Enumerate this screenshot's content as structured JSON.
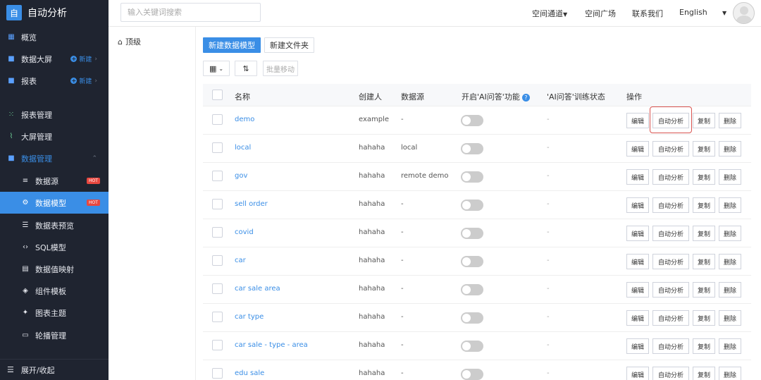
{
  "app": {
    "logo": "自",
    "title": "自动分析"
  },
  "sidebar": {
    "items": [
      {
        "label": "概览"
      },
      {
        "label": "数据大屏",
        "new_label": "新建"
      },
      {
        "label": "报表",
        "new_label": "新建"
      },
      {
        "label": "报表管理"
      },
      {
        "label": "大屏管理"
      },
      {
        "label": "数据管理"
      },
      {
        "label": "数据源",
        "badge": "HOT"
      },
      {
        "label": "数据模型",
        "badge": "HOT"
      },
      {
        "label": "数据表预览"
      },
      {
        "label": "SQL模型"
      },
      {
        "label": "数据值映射"
      },
      {
        "label": "组件模板"
      },
      {
        "label": "图表主题"
      },
      {
        "label": "轮播管理"
      }
    ],
    "footer_label": "展开/收起"
  },
  "topbar": {
    "search_placeholder": "输入关键词搜索",
    "links": [
      "空间通道",
      "空间广场",
      "联系我们",
      "English"
    ]
  },
  "tree": {
    "root_label": "顶级"
  },
  "toolbar": {
    "new_model": "新建数据模型",
    "new_folder": "新建文件夹",
    "batch_move": "批量移动"
  },
  "table": {
    "headers": [
      "名称",
      "创建人",
      "数据源",
      "开启'AI问答'功能",
      "'AI问答'训练状态",
      "操作"
    ],
    "rows": [
      {
        "name": "demo",
        "creator": "example",
        "source": "-",
        "status": "-"
      },
      {
        "name": "local",
        "creator": "hahaha",
        "source": "local",
        "status": "-"
      },
      {
        "name": "gov",
        "creator": "hahaha",
        "source": "remote demo",
        "status": "-"
      },
      {
        "name": "sell order",
        "creator": "hahaha",
        "source": "-",
        "status": "-"
      },
      {
        "name": "covid",
        "creator": "hahaha",
        "source": "-",
        "status": "-"
      },
      {
        "name": "car",
        "creator": "hahaha",
        "source": "-",
        "status": "-"
      },
      {
        "name": "car sale area",
        "creator": "hahaha",
        "source": "-",
        "status": "-"
      },
      {
        "name": "car type",
        "creator": "hahaha",
        "source": "-",
        "status": "-"
      },
      {
        "name": "car sale - type - area",
        "creator": "hahaha",
        "source": "-",
        "status": "-"
      },
      {
        "name": "edu sale",
        "creator": "hahaha",
        "source": "-",
        "status": "-"
      }
    ],
    "actions": {
      "edit": "编辑",
      "auto": "自动分析",
      "copy": "复制",
      "delete": "删除"
    }
  },
  "colors": {
    "accent": "#3a8ee6",
    "sidebar_bg": "#1f2430",
    "hot": "#e8473f",
    "highlight": "#d9534f"
  }
}
